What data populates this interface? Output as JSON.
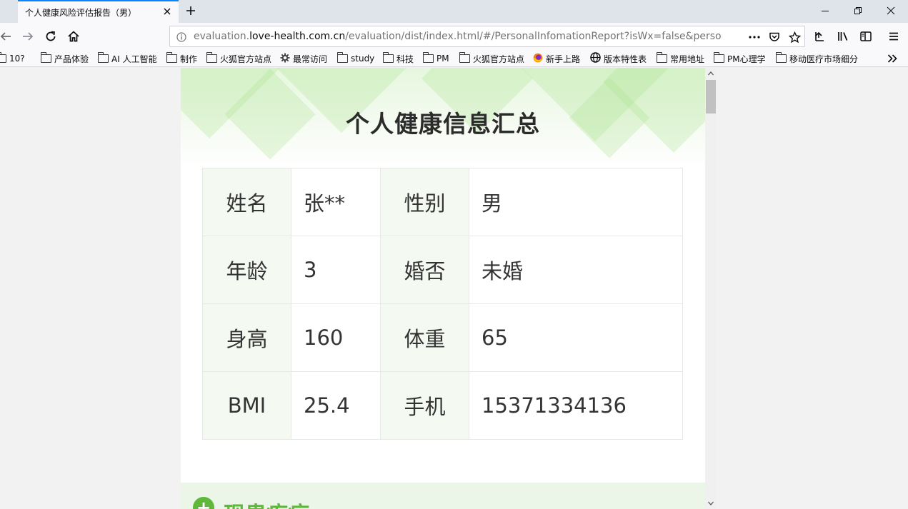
{
  "browser": {
    "tab_title": "个人健康风险评估报告（男）",
    "url_prefix": "evaluation.",
    "url_host": "love-health.com.cn",
    "url_path": "/evaluation/dist/index.html/#/PersonalInfomationReport?isWx=false&personId=p",
    "icons": [
      "back-icon",
      "forward-icon",
      "reload-icon",
      "home-icon",
      "info-icon",
      "more-icon",
      "pocket-icon",
      "star-icon",
      "library-icon",
      "sidebar-icon",
      "menu-icon",
      "overflow-chevron-icon"
    ]
  },
  "bookmarks": [
    {
      "label": "10?",
      "icon": "folder"
    },
    {
      "label": "产品体验",
      "icon": "folder"
    },
    {
      "label": "AI 人工智能",
      "icon": "folder"
    },
    {
      "label": "制作",
      "icon": "folder"
    },
    {
      "label": "火狐官方站点",
      "icon": "folder"
    },
    {
      "label": "最常访问",
      "icon": "gear"
    },
    {
      "label": "study",
      "icon": "folder"
    },
    {
      "label": "科技",
      "icon": "folder"
    },
    {
      "label": "PM",
      "icon": "folder"
    },
    {
      "label": "火狐官方站点",
      "icon": "folder"
    },
    {
      "label": "新手上路",
      "icon": "firefox"
    },
    {
      "label": "版本特性表",
      "icon": "globe"
    },
    {
      "label": "常用地址",
      "icon": "folder"
    },
    {
      "label": "PM心理学",
      "icon": "folder"
    },
    {
      "label": "移动医疗市场细分",
      "icon": "folder"
    }
  ],
  "page": {
    "title": "个人健康信息汇总",
    "rows": [
      {
        "label1": "姓名",
        "value1": "张**",
        "label2": "性别",
        "value2": "男"
      },
      {
        "label1": "年龄",
        "value1": "3",
        "label2": "婚否",
        "value2": "未婚"
      },
      {
        "label1": "身高",
        "value1": "160",
        "label2": "体重",
        "value2": "65"
      },
      {
        "label1": "BMI",
        "value1": "25.4",
        "label2": "手机",
        "value2": "15371334136"
      }
    ],
    "section_title": "现患疾病",
    "accent_color": "#5fb83a"
  }
}
